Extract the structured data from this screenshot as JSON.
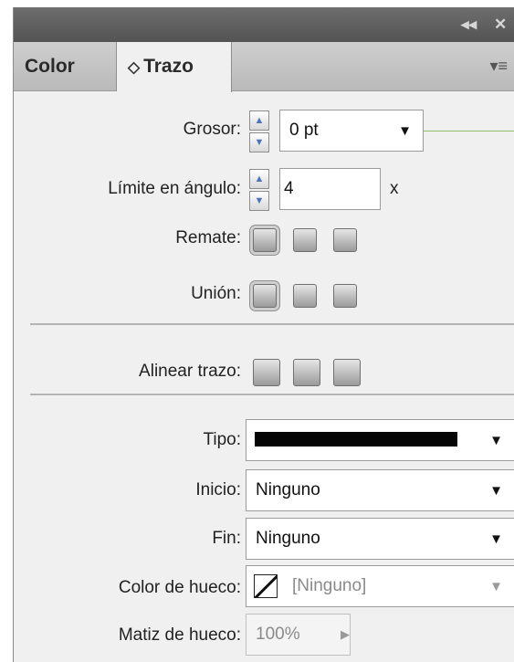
{
  "tabs": {
    "color": "Color",
    "trazo": "Trazo",
    "arrows": "◇"
  },
  "titlebar": {
    "collapse": "◂◂",
    "close": "✕"
  },
  "menu_icon": "▾≡",
  "grosor": {
    "label": "Grosor:",
    "value": "0 pt"
  },
  "limite": {
    "label": "Límite en ángulo:",
    "value": "4",
    "suffix": "x"
  },
  "remate": {
    "label": "Remate:"
  },
  "union": {
    "label": "Unión:"
  },
  "alinear": {
    "label": "Alinear trazo:"
  },
  "tipo": {
    "label": "Tipo:"
  },
  "inicio": {
    "label": "Inicio:",
    "value": "Ninguno"
  },
  "fin": {
    "label": "Fin:",
    "value": "Ninguno"
  },
  "color_hueco": {
    "label": "Color de hueco:",
    "value": "[Ninguno]"
  },
  "matiz_hueco": {
    "label": "Matiz de hueco:",
    "value": "100%"
  },
  "colors": {
    "accent_line": "#8fbf6a",
    "disabled_text": "#8a8a8a"
  }
}
